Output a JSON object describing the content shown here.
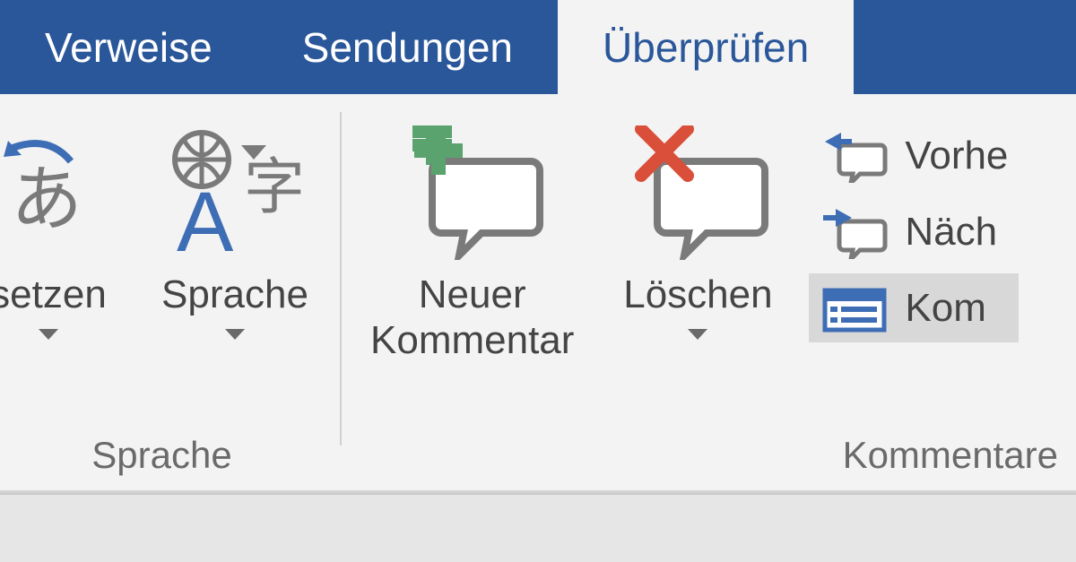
{
  "tabs": {
    "verweise": "Verweise",
    "sendungen": "Sendungen",
    "ueberpruefen": "Überprüfen"
  },
  "groups": {
    "language": {
      "label": "Sprache",
      "translate": "setzen",
      "language": "Sprache"
    },
    "comments": {
      "label": "Kommentare",
      "new_comment": "Neuer\nKommentar",
      "delete": "Löschen",
      "previous": "Vorhe",
      "next": "Näch",
      "show": "Kom"
    }
  },
  "colors": {
    "ribbon_blue": "#2a579a",
    "accent_green": "#5aa36e",
    "accent_red": "#d94f3a",
    "icon_gray": "#7a7a7a",
    "icon_blue": "#3d6db5"
  }
}
